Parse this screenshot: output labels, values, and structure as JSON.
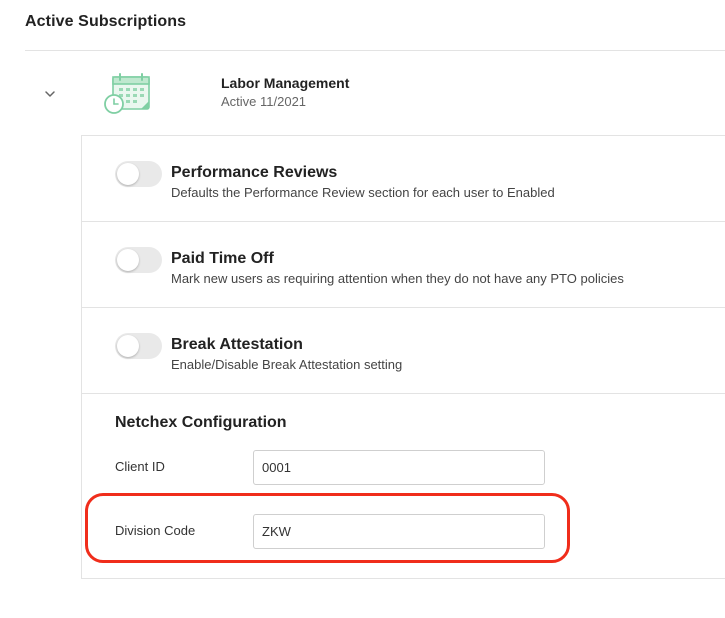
{
  "section": {
    "title": "Active Subscriptions"
  },
  "subscription": {
    "expand_icon": "chevron-down-icon",
    "product_icon": "calendar-clock-icon",
    "name": "Labor Management",
    "status": "Active 11/2021"
  },
  "settings": [
    {
      "title": "Performance Reviews",
      "description": "Defaults the Performance Review section for each user to Enabled",
      "enabled": false
    },
    {
      "title": "Paid Time Off",
      "description": "Mark new users as requiring attention when they do not have any PTO policies",
      "enabled": false
    },
    {
      "title": "Break Attestation",
      "description": "Enable/Disable Break Attestation setting",
      "enabled": false
    }
  ],
  "config": {
    "title": "Netchex Configuration",
    "client_id_label": "Client ID",
    "client_id_value": "0001",
    "division_code_label": "Division Code",
    "division_code_value": "ZKW"
  },
  "colors": {
    "accent_icon": "#7fcfa3",
    "highlight": "#f02d1b",
    "toggle_off": "#e9e9e9",
    "divider": "#e3e3e3"
  }
}
